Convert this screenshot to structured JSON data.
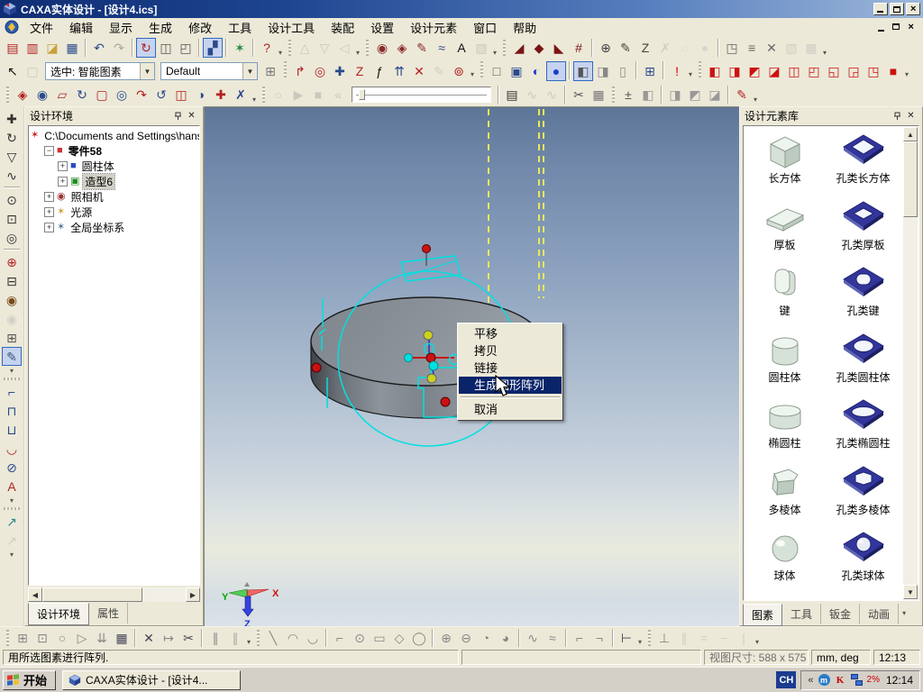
{
  "titlebar": {
    "title": "CAXA实体设计 - [设计4.ics]"
  },
  "menubar": {
    "items": [
      "文件",
      "编辑",
      "显示",
      "生成",
      "修改",
      "工具",
      "设计工具",
      "装配",
      "设置",
      "设计元素",
      "窗口",
      "帮助"
    ]
  },
  "combos": {
    "select": "选中: 智能图素",
    "style": "Default"
  },
  "toolbars": {
    "row1": [
      {
        "n": "new-design",
        "g": "▤",
        "c": "#b22222"
      },
      {
        "n": "new-draft",
        "g": "▥",
        "c": "#b22222"
      },
      {
        "n": "open-file",
        "g": "◪",
        "c": "#c9a23a"
      },
      {
        "n": "save-file",
        "g": "▦",
        "c": "#2a4a8c"
      },
      {
        "n": "undo",
        "g": "↶",
        "c": "#2a4a8c",
        "sep": true
      },
      {
        "n": "redo",
        "g": "↷",
        "c": "#2a4a8c",
        "d": true
      },
      {
        "n": "rotate-mode",
        "g": "↻",
        "c": "#b22222",
        "p": true,
        "sep": true
      },
      {
        "n": "drag-copy",
        "g": "◫",
        "c": "#555555"
      },
      {
        "n": "lock-element",
        "g": "◰",
        "c": "#555555"
      },
      {
        "n": "design-tree-view",
        "g": "▞",
        "c": "#2a4a8c",
        "p": true,
        "sep": true
      },
      {
        "n": "surface-mesh",
        "g": "✶",
        "c": "#1f8a3a",
        "sep": true
      },
      {
        "n": "context-help",
        "g": "?",
        "c": "#b22222",
        "sep": true
      },
      {
        "dd": true
      },
      {
        "n": "gray-tool-1",
        "g": "△",
        "c": "#999999",
        "d": true,
        "grip": true
      },
      {
        "n": "gray-tool-2",
        "g": "▽",
        "c": "#999999",
        "d": true
      },
      {
        "n": "gray-tool-3",
        "g": "◁",
        "c": "#999999",
        "d": true
      },
      {
        "dd": true
      },
      {
        "n": "stamp-tool",
        "g": "◉",
        "c": "#8a2b2b",
        "grip": true
      },
      {
        "n": "pattern-tool",
        "g": "◈",
        "c": "#8a2b2b"
      },
      {
        "n": "sketch-pen",
        "g": "✎",
        "c": "#8a2b2b"
      },
      {
        "n": "smooth-tool",
        "g": "≈",
        "c": "#2a4a8c"
      },
      {
        "n": "text-tool",
        "g": "A",
        "c": "#111111"
      },
      {
        "n": "gray-page",
        "g": "▨",
        "c": "#999999",
        "d": true
      },
      {
        "dd": true
      },
      {
        "n": "red-wedge-1",
        "g": "◢",
        "c": "#7a1414",
        "grip": true
      },
      {
        "n": "red-wedge-2",
        "g": "◆",
        "c": "#7a1414"
      },
      {
        "n": "red-wedge-3",
        "g": "◣",
        "c": "#7a1414"
      },
      {
        "n": "red-fence",
        "g": "#",
        "c": "#7a1414"
      },
      {
        "n": "press-stamp",
        "g": "⊕",
        "c": "#444444",
        "sep": true
      },
      {
        "n": "edit-pen",
        "g": "✎",
        "c": "#444444"
      },
      {
        "n": "edit-z",
        "g": "Z",
        "c": "#444444"
      },
      {
        "n": "gray-run",
        "g": "✗",
        "c": "#aaaaaa",
        "d": true
      },
      {
        "n": "gray-dot",
        "g": "◌",
        "c": "#aaaaaa",
        "d": true
      },
      {
        "n": "gray-ball",
        "g": "●",
        "c": "#bbbbbb",
        "d": true
      },
      {
        "n": "page-flip",
        "g": "◳",
        "c": "#666666",
        "sep": true
      },
      {
        "n": "layer-stack",
        "g": "≡",
        "c": "#666666"
      },
      {
        "n": "break-x",
        "g": "✕",
        "c": "#666666"
      },
      {
        "n": "gray-box-1",
        "g": "▧",
        "c": "#aaaaaa",
        "d": true
      },
      {
        "n": "gray-box-2",
        "g": "▩",
        "c": "#aaaaaa",
        "d": true
      },
      {
        "dd": true
      }
    ],
    "row2a": [
      {
        "n": "select-cursor",
        "g": "↖",
        "c": "#111111"
      },
      {
        "n": "select-rect",
        "g": "▢",
        "c": "#999999",
        "d": true
      }
    ],
    "row2b": [
      {
        "n": "insert-link",
        "g": "⊞",
        "c": "#777777"
      },
      {
        "n": "reposition",
        "g": "↱",
        "c": "#b22222",
        "grip": true
      },
      {
        "n": "orient-globe",
        "g": "◎",
        "c": "#b22222"
      },
      {
        "n": "pinwheel",
        "g": "✚",
        "c": "#2a4a8c"
      },
      {
        "n": "z-translate",
        "g": "Z",
        "c": "#b22222"
      },
      {
        "n": "fx-parameter",
        "g": "ƒ",
        "c": "#111111"
      },
      {
        "n": "align-up",
        "g": "⇈",
        "c": "#2a4a8c"
      },
      {
        "n": "no-snap",
        "g": "✕",
        "c": "#b22222"
      },
      {
        "n": "gray-pen",
        "g": "✎",
        "c": "#aaaaaa",
        "d": true
      },
      {
        "n": "material-roll",
        "g": "⊚",
        "c": "#b22222"
      },
      {
        "dd": true
      },
      {
        "n": "wireframe-view",
        "g": "□",
        "c": "#555555",
        "grip": true
      },
      {
        "n": "hidden-line-view",
        "g": "▣",
        "c": "#2a4a8c"
      },
      {
        "n": "shaded-half",
        "g": "◐",
        "c": "#1a3ec8"
      },
      {
        "n": "shaded-render",
        "g": "●",
        "c": "#1a3ec8",
        "p": true
      },
      {
        "n": "show-solid",
        "g": "◧",
        "c": "#555555",
        "p": true,
        "sep": true
      },
      {
        "n": "show-ghost",
        "g": "◨",
        "c": "#888888"
      },
      {
        "n": "show-cylinder",
        "g": "▯",
        "c": "#888888"
      },
      {
        "n": "spreadsheet",
        "g": "⊞",
        "c": "#2a4a8c",
        "sep": true
      },
      {
        "n": "render-alert",
        "g": "!",
        "c": "#cc0000",
        "sep": true
      },
      {
        "dd": true
      },
      {
        "n": "view-iso",
        "g": "◧",
        "c": "#cc1111",
        "grip": true
      },
      {
        "n": "view-front",
        "g": "◨",
        "c": "#cc1111"
      },
      {
        "n": "view-back",
        "g": "◩",
        "c": "#cc1111"
      },
      {
        "n": "view-left",
        "g": "◪",
        "c": "#cc1111"
      },
      {
        "n": "view-right",
        "g": "◫",
        "c": "#cc1111"
      },
      {
        "n": "view-top",
        "g": "◰",
        "c": "#cc1111"
      },
      {
        "n": "view-bottom",
        "g": "◱",
        "c": "#cc1111"
      },
      {
        "n": "view-axon-1",
        "g": "◲",
        "c": "#cc1111"
      },
      {
        "n": "view-axon-2",
        "g": "◳",
        "c": "#cc1111"
      },
      {
        "n": "view-custom",
        "g": "■",
        "c": "#cc1111"
      },
      {
        "dd": true
      }
    ],
    "row3": [
      {
        "n": "feat-extrude",
        "g": "◈",
        "c": "#b22222",
        "grip": true
      },
      {
        "n": "feat-cut",
        "g": "◉",
        "c": "#2a4a8c"
      },
      {
        "n": "feat-sweep",
        "g": "▱",
        "c": "#b22222"
      },
      {
        "n": "feat-revolve",
        "g": "↻",
        "c": "#2a4a8c"
      },
      {
        "n": "feat-shell",
        "g": "▢",
        "c": "#b22222"
      },
      {
        "n": "feat-loft",
        "g": "◎",
        "c": "#2a4a8c"
      },
      {
        "n": "feat-bend",
        "g": "↷",
        "c": "#b22222"
      },
      {
        "n": "feat-twist",
        "g": "↺",
        "c": "#2a4a8c"
      },
      {
        "n": "feat-slice",
        "g": "◫",
        "c": "#b22222"
      },
      {
        "n": "feat-mirror",
        "g": "◑",
        "c": "#2a4a8c"
      },
      {
        "n": "feat-array",
        "g": "✚",
        "c": "#b22222"
      },
      {
        "n": "feat-remove",
        "g": "✗",
        "c": "#2a4a8c"
      },
      {
        "dd": true
      },
      {
        "n": "anim-record",
        "g": "○",
        "c": "#999999",
        "d": true,
        "grip": true
      },
      {
        "n": "anim-play",
        "g": "▶",
        "c": "#999999",
        "d": true
      },
      {
        "n": "anim-stop",
        "g": "■",
        "c": "#999999",
        "d": true
      },
      {
        "n": "anim-rewind",
        "g": "«",
        "c": "#999999",
        "d": true
      },
      {
        "slider": true
      },
      {
        "n": "film-strip",
        "g": "▤",
        "c": "#333333",
        "sep": true
      },
      {
        "n": "curve-path-1",
        "g": "∿",
        "c": "#999999",
        "d": true
      },
      {
        "n": "curve-path-2",
        "g": "∿",
        "c": "#999999",
        "d": true
      },
      {
        "n": "clip-tool",
        "g": "✂",
        "c": "#555555",
        "sep": true
      },
      {
        "n": "film-edit",
        "g": "▦",
        "c": "#777777"
      },
      {
        "n": "tolerance",
        "g": "±",
        "c": "#555555",
        "grip": true
      },
      {
        "n": "option-cube-1",
        "g": "◧",
        "c": "#999999"
      },
      {
        "n": "option-cube-2",
        "g": "◨",
        "c": "#999999",
        "sep": true
      },
      {
        "n": "option-cube-3",
        "g": "◩",
        "c": "#999999"
      },
      {
        "n": "option-cube-4",
        "g": "◪",
        "c": "#999999"
      },
      {
        "n": "render-paint",
        "g": "✎",
        "c": "#b22222",
        "sep": true
      },
      {
        "dd": true
      }
    ],
    "left": [
      {
        "n": "pan-view",
        "g": "✚",
        "c": "#333333"
      },
      {
        "n": "rotate-view-3d",
        "g": "↻",
        "c": "#333333"
      },
      {
        "n": "drop-anchor",
        "g": "▽",
        "c": "#333333"
      },
      {
        "n": "fly-path",
        "g": "∿",
        "c": "#333333"
      },
      {
        "n": "zoom",
        "g": "⊙",
        "c": "#333333",
        "sep": true
      },
      {
        "n": "zoom-window",
        "g": "⊡",
        "c": "#333333"
      },
      {
        "n": "zoom-all",
        "g": "◎",
        "c": "#333333"
      },
      {
        "n": "zoom-target",
        "g": "⊕",
        "c": "#b22222",
        "sep": true
      },
      {
        "n": "view-monitor",
        "g": "⊟",
        "c": "#333333"
      },
      {
        "n": "camera-rotate",
        "g": "◉",
        "c": "#7a4a1a"
      },
      {
        "n": "camera-static",
        "g": "◉",
        "c": "#aaaaaa",
        "d": true
      },
      {
        "n": "camera-multi",
        "g": "⊞",
        "c": "#555555"
      },
      {
        "n": "render-brush",
        "g": "✎",
        "c": "#335577",
        "p": true
      },
      {
        "dd": true
      },
      {
        "n": "dim-corner",
        "g": "⌐",
        "c": "#2a4a8c",
        "grip": true
      },
      {
        "n": "dim-horizontal",
        "g": "⊓",
        "c": "#2a4a8c"
      },
      {
        "n": "dim-vertical",
        "g": "⊔",
        "c": "#2a4a8c"
      },
      {
        "n": "dim-arc",
        "g": "◡",
        "c": "#b22222"
      },
      {
        "n": "dim-diameter",
        "g": "⊘",
        "c": "#2a4a8c"
      },
      {
        "n": "dim-text",
        "g": "A",
        "c": "#b22222"
      },
      {
        "dd": true
      },
      {
        "n": "eyedropper",
        "g": "↗",
        "c": "#2a8a8a",
        "grip": true
      },
      {
        "n": "eyedropper-off",
        "g": "↗",
        "c": "#aaaaaa",
        "d": true
      },
      {
        "dd": true
      }
    ],
    "bottom": [
      {
        "n": "sk-two-view",
        "g": "⊞",
        "c": "#888888",
        "grip": true
      },
      {
        "n": "sk-scale",
        "g": "⊡",
        "c": "#888888"
      },
      {
        "n": "sk-circle-ref",
        "g": "○",
        "c": "#888888"
      },
      {
        "n": "sk-mirror",
        "g": "▷",
        "c": "#888888"
      },
      {
        "n": "sk-project",
        "g": "⇊",
        "c": "#888888"
      },
      {
        "n": "sk-hatch",
        "g": "▦",
        "c": "#444455"
      },
      {
        "n": "sk-delete",
        "g": "✕",
        "c": "#444455",
        "sep": true
      },
      {
        "n": "sk-trim",
        "g": "↦",
        "c": "#888888"
      },
      {
        "n": "sk-cut",
        "g": "✂",
        "c": "#444455"
      },
      {
        "n": "sk-offset-1",
        "g": "∥",
        "c": "#888888",
        "sep": true
      },
      {
        "n": "sk-offset-2",
        "g": "∥",
        "c": "#aaaaaa"
      },
      {
        "dd": true
      },
      {
        "n": "sk-line",
        "g": "╲",
        "c": "#888888",
        "grip": true
      },
      {
        "n": "sk-arc-1",
        "g": "◠",
        "c": "#888888"
      },
      {
        "n": "sk-arc-2",
        "g": "◡",
        "c": "#888888"
      },
      {
        "n": "sk-corner-dim",
        "g": "⌐",
        "c": "#888888",
        "sep": true
      },
      {
        "n": "sk-circle-3pt",
        "g": "⊙",
        "c": "#888888"
      },
      {
        "n": "sk-rectangle",
        "g": "▭",
        "c": "#888888"
      },
      {
        "n": "sk-diamond",
        "g": "◇",
        "c": "#888888"
      },
      {
        "n": "sk-polygon",
        "g": "◯",
        "c": "#888888"
      },
      {
        "n": "sk-circle-center",
        "g": "⊕",
        "c": "#888888",
        "sep": true
      },
      {
        "n": "sk-ellipse-1",
        "g": "⊖",
        "c": "#888888"
      },
      {
        "n": "sk-ellipse-2",
        "g": "◔",
        "c": "#888888"
      },
      {
        "n": "sk-arc-3",
        "g": "◕",
        "c": "#888888"
      },
      {
        "n": "sk-spline-1",
        "g": "∿",
        "c": "#888888",
        "sep": true
      },
      {
        "n": "sk-spline-2",
        "g": "≈",
        "c": "#888888"
      },
      {
        "n": "sk-chamfer",
        "g": "⌐",
        "c": "#888888",
        "sep": true
      },
      {
        "n": "sk-fillet",
        "g": "¬",
        "c": "#888888"
      },
      {
        "n": "sk-dimension",
        "g": "⊢",
        "c": "#444455",
        "sep": true
      },
      {
        "dd": true
      },
      {
        "n": "con-perpendicular",
        "g": "⊥",
        "c": "#888888",
        "grip": true
      },
      {
        "n": "con-parallel",
        "g": "∥",
        "c": "#aaaaaa",
        "d": true
      },
      {
        "n": "con-equal",
        "g": "=",
        "c": "#aaaaaa",
        "d": true
      },
      {
        "n": "con-horizontal",
        "g": "−",
        "c": "#aaaaaa",
        "d": true
      },
      {
        "n": "con-vertical",
        "g": "|",
        "c": "#aaaaaa",
        "d": true
      },
      {
        "dd": true
      }
    ]
  },
  "left_panel": {
    "title": "设计环境",
    "tree": {
      "root": "C:\\Documents and Settings\\hanshu",
      "nodes": [
        {
          "label": "零件58",
          "depth": 1,
          "exp": "-",
          "icon": "part",
          "bold": true
        },
        {
          "label": "圆柱体",
          "depth": 2,
          "exp": "+",
          "icon": "cylinder"
        },
        {
          "label": "造型6",
          "depth": 2,
          "exp": "+",
          "icon": "shape",
          "selected": true
        },
        {
          "label": "照相机",
          "depth": 1,
          "exp": "+",
          "icon": "camera"
        },
        {
          "label": "光源",
          "depth": 1,
          "exp": "+",
          "icon": "light"
        },
        {
          "label": "全局坐标系",
          "depth": 1,
          "exp": "+",
          "icon": "coords"
        }
      ]
    },
    "tabs": [
      {
        "label": "设计环境",
        "active": true
      },
      {
        "label": "属性",
        "active": false
      }
    ]
  },
  "viewport": {
    "triad": {
      "x": "X",
      "y": "Y",
      "z": "Z"
    }
  },
  "context_menu": {
    "items": [
      {
        "label": "平移"
      },
      {
        "label": "拷贝"
      },
      {
        "label": "链接"
      },
      {
        "label": "生成圆形阵列",
        "highlighted": true
      },
      {
        "separator": true
      },
      {
        "label": "取消"
      }
    ]
  },
  "right_panel": {
    "title": "设计元素库",
    "items": [
      {
        "label": "长方体",
        "type": "cube"
      },
      {
        "label": "孔类长方体",
        "type": "hole-cube"
      },
      {
        "label": "厚板",
        "type": "plate"
      },
      {
        "label": "孔类厚板",
        "type": "hole-plate"
      },
      {
        "label": "键",
        "type": "key"
      },
      {
        "label": "孔类键",
        "type": "hole-key"
      },
      {
        "label": "圆柱体",
        "type": "cylinder"
      },
      {
        "label": "孔类圆柱体",
        "type": "hole-cylinder"
      },
      {
        "label": "椭圆柱",
        "type": "ellcyl"
      },
      {
        "label": "孔类椭圆柱",
        "type": "hole-ellcyl"
      },
      {
        "label": "多棱体",
        "type": "prism"
      },
      {
        "label": "孔类多棱体",
        "type": "hole-prism"
      },
      {
        "label": "球体",
        "type": "sphere"
      },
      {
        "label": "孔类球体",
        "type": "hole-sphere"
      }
    ],
    "tabs": [
      {
        "label": "图素",
        "active": true
      },
      {
        "label": "工具",
        "active": false
      },
      {
        "label": "钣金",
        "active": false
      },
      {
        "label": "动画",
        "active": false
      }
    ]
  },
  "status_bar": {
    "message": "用所选图素进行阵列.",
    "view_size": "视图尺寸: 588 x 575",
    "units": "mm, deg",
    "time": "12:13"
  },
  "taskbar": {
    "start": "开始",
    "task": "CAXA实体设计 - [设计4...",
    "lang": "CH",
    "tray_pct": "2%",
    "clock": "12:14"
  }
}
